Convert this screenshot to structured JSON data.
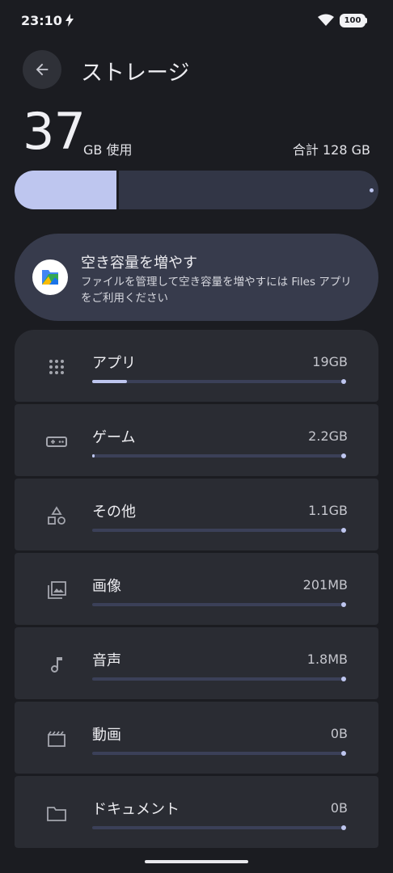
{
  "status": {
    "time": "23:10",
    "battery": "100"
  },
  "header": {
    "title": "ストレージ"
  },
  "summary": {
    "used_value": "37",
    "used_unit": "GB 使用",
    "total": "合計 128 GB",
    "used_fraction": 0.28
  },
  "free_space": {
    "title": "空き容量を増やす",
    "description": "ファイルを管理して空き容量を増やすには Files アプリをご利用ください",
    "icon": "files-app-icon"
  },
  "categories": [
    {
      "label": "アプリ",
      "size": "19GB",
      "fraction": 0.14,
      "icon": "apps-grid-icon"
    },
    {
      "label": "ゲーム",
      "size": "2.2GB",
      "fraction": 0.01,
      "icon": "gamepad-icon"
    },
    {
      "label": "その他",
      "size": "1.1GB",
      "fraction": 0.0,
      "icon": "shapes-icon"
    },
    {
      "label": "画像",
      "size": "201MB",
      "fraction": 0.0,
      "icon": "photo-library-icon"
    },
    {
      "label": "音声",
      "size": "1.8MB",
      "fraction": 0.0,
      "icon": "music-note-icon"
    },
    {
      "label": "動画",
      "size": "0B",
      "fraction": 0.0,
      "icon": "movie-icon"
    },
    {
      "label": "ドキュメント",
      "size": "0B",
      "fraction": 0.0,
      "icon": "folder-icon"
    }
  ],
  "colors": {
    "accent": "#bec6ef",
    "background": "#1b1c21",
    "card": "#2a2c33"
  }
}
